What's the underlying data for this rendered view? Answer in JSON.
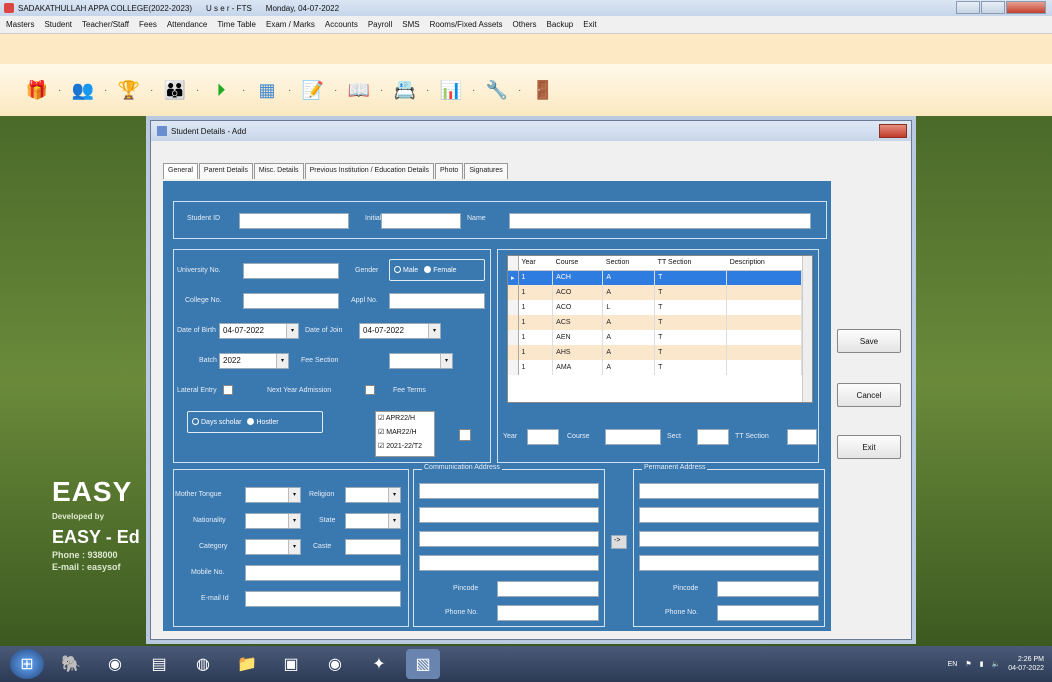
{
  "window": {
    "college": "SADAKATHULLAH APPA COLLEGE(2022-2023)",
    "user": "U s e r - FTS",
    "date": "Monday, 04-07-2022"
  },
  "menu": [
    "Masters",
    "Student",
    "Teacher/Staff",
    "Fees",
    "Attendance",
    "Time Table",
    "Exam / Marks",
    "Accounts",
    "Payroll",
    "SMS",
    "Rooms/Fixed Assets",
    "Others",
    "Backup",
    "Exit"
  ],
  "toolbar_icons": [
    "gift-icon",
    "users-icon",
    "trophy-icon",
    "people-icon",
    "play-icon",
    "calendar-icon",
    "notes-icon",
    "reader-icon",
    "contacts-icon",
    "chart-icon",
    "tools-icon",
    "exit-door-icon"
  ],
  "brand": {
    "name": "EASY",
    "developed_by": "Developed by",
    "company": "EASY - Ed",
    "phone": "Phone : 938000",
    "email": "E-mail : easysof"
  },
  "dialog": {
    "title": "Student Details - Add",
    "tabs": [
      "General",
      "Parent Details",
      "Misc. Details",
      "Previous Institution / Education Details",
      "Photo",
      "Signatures"
    ],
    "labels": {
      "student_id": "Student ID",
      "initial": "Initial",
      "name": "Name",
      "university_no": "University No.",
      "gender": "Gender",
      "male": "Male",
      "female": "Female",
      "college_no": "College No.",
      "appl_no": "Appl No.",
      "dob": "Date of Birth",
      "doj": "Date of Join",
      "batch": "Batch",
      "fee_section": "Fee Section",
      "lateral_entry": "Lateral Entry",
      "next_year_admission": "Next Year Admission",
      "fee_terms": "Fee Terms",
      "days_scholar": "Days scholar",
      "hostler": "Hostler",
      "year": "Year",
      "course": "Course",
      "sect": "Sect",
      "tt_section": "TT Section",
      "mother_tongue": "Mother Tongue",
      "religion": "Religion",
      "nationality": "Nationality",
      "state": "State",
      "category": "Category",
      "caste": "Caste",
      "mobile_no": "Mobile No.",
      "email_id": "E-mail Id",
      "communication_address": "Communication Address",
      "permanent_address": "Permanent Address",
      "pincode": "Pincode",
      "phone_no": "Phone No."
    },
    "values": {
      "dob": "04-07-2022",
      "doj": "04-07-2022",
      "batch": "2022"
    },
    "fee_terms": [
      "APR22/H",
      "MAR22/H",
      "2021-22/T2"
    ],
    "grid": {
      "headers": [
        "Year",
        "Course",
        "Section",
        "TT Section",
        "Description"
      ],
      "rows": [
        [
          "1",
          "ACH",
          "A",
          "T",
          ""
        ],
        [
          "1",
          "ACO",
          "A",
          "T",
          ""
        ],
        [
          "1",
          "ACO",
          "L",
          "T",
          ""
        ],
        [
          "1",
          "ACS",
          "A",
          "T",
          ""
        ],
        [
          "1",
          "AEN",
          "A",
          "T",
          ""
        ],
        [
          "1",
          "AHS",
          "A",
          "T",
          ""
        ],
        [
          "1",
          "AMA",
          "A",
          "T",
          ""
        ]
      ]
    },
    "buttons": {
      "save": "Save",
      "cancel": "Cancel",
      "exit": "Exit",
      "copy": "->"
    }
  },
  "taskbar": {
    "lang": "EN",
    "time": "2:26 PM",
    "date": "04-07-2022"
  }
}
